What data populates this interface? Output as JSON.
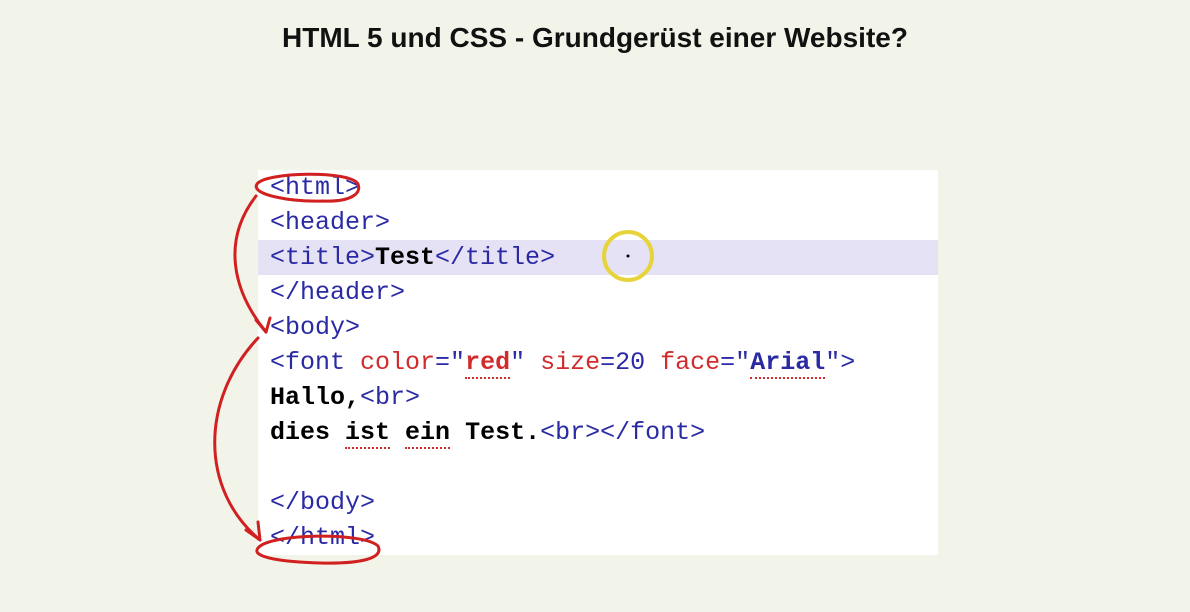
{
  "heading": "HTML 5 und CSS - Grundgerüst einer Website?",
  "code": {
    "line1_open": "<html>",
    "line2_open": "<header>",
    "line3_title_open": "<title>",
    "line3_text": "Test",
    "line3_title_close": "</title>",
    "line4_close": "</header>",
    "line5_open": "<body>",
    "line6_font_open": "<font",
    "line6_attr_color": " color",
    "line6_eq1": "=",
    "line6_q1": "\"",
    "line6_color_val": "red",
    "line6_q2": "\"",
    "line6_attr_size": " size",
    "line6_eq2": "=",
    "line6_size_val": "20",
    "line6_attr_face": " face",
    "line6_eq3": "=",
    "line6_q3": "\"",
    "line6_face_val": "Arial",
    "line6_q4": "\"",
    "line6_close": ">",
    "line7_text": "Hallo,",
    "line7_br": "<br>",
    "line8_dies": "dies ",
    "line8_ist": "ist",
    "line8_sp1": " ",
    "line8_ein": "ein",
    "line8_sp2": " ",
    "line8_test": "Test.",
    "line8_br": "<br>",
    "line8_font_close": "</font>",
    "line9_blank": " ",
    "line10_close": "</body>",
    "line11_close": "</html>"
  }
}
